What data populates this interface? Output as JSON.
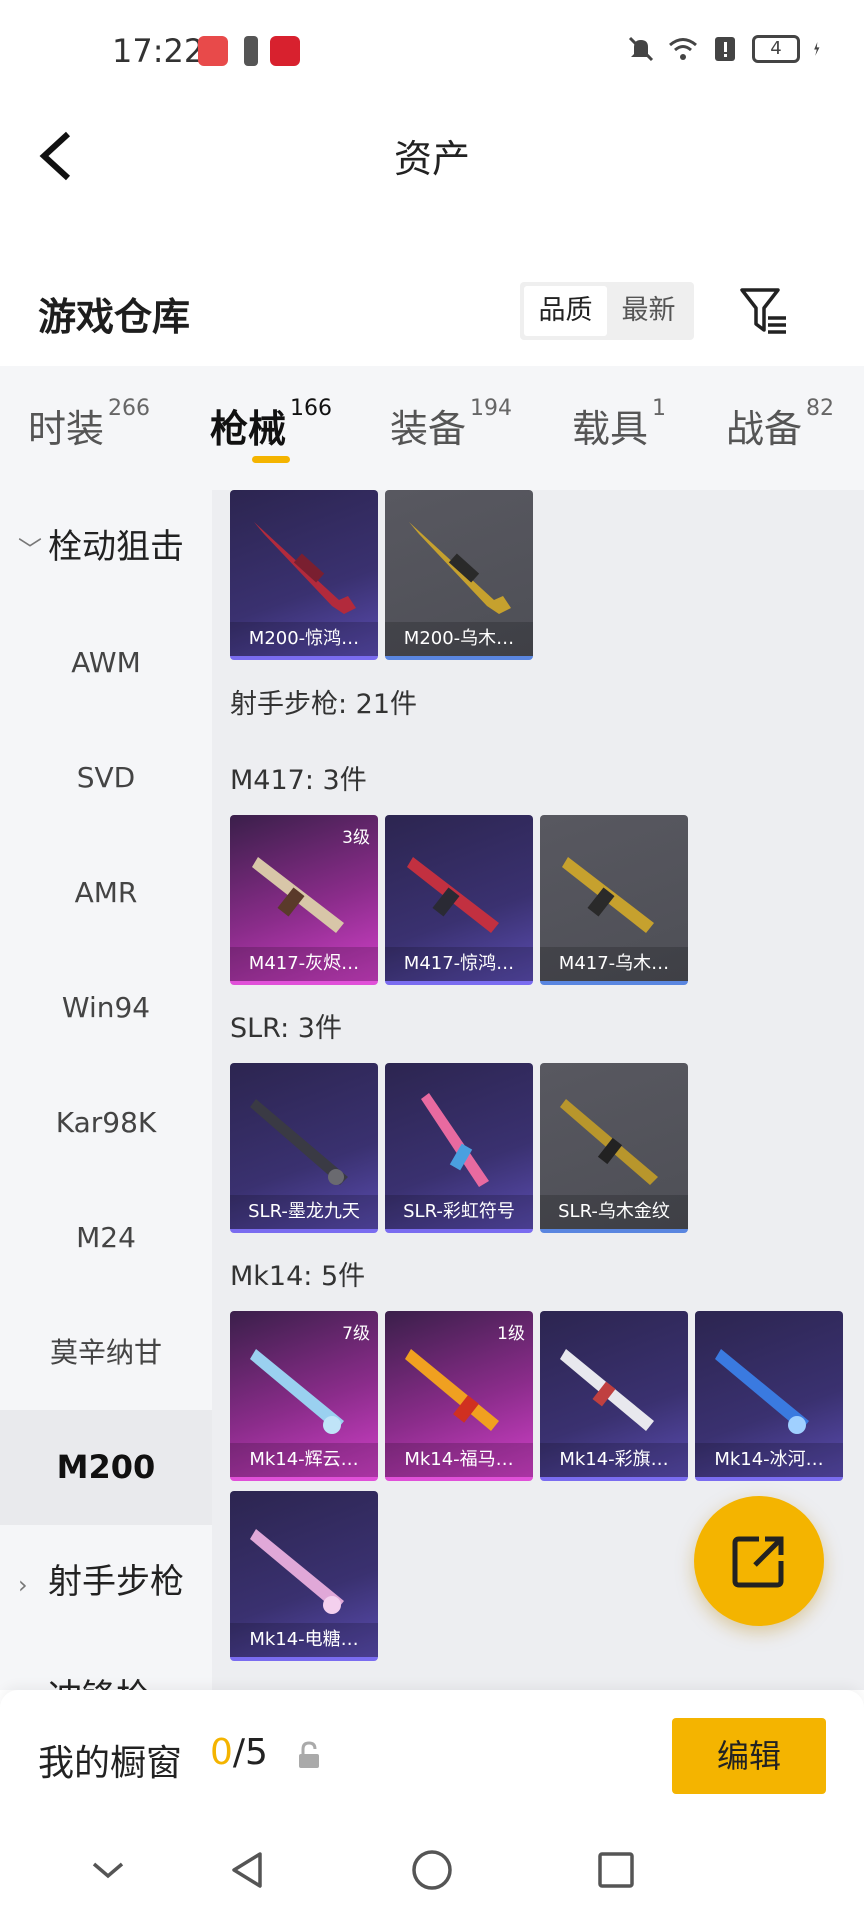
{
  "status_bar": {
    "time": "17:22",
    "battery": "4"
  },
  "header": {
    "title": "资产"
  },
  "warehouse": {
    "title": "游戏仓库",
    "sort_options": [
      "品质",
      "最新"
    ],
    "active_sort": "品质"
  },
  "category_tabs": [
    {
      "label": "时装",
      "count": "266",
      "active": false
    },
    {
      "label": "枪械",
      "count": "166",
      "active": true
    },
    {
      "label": "装备",
      "count": "194",
      "active": false
    },
    {
      "label": "载具",
      "count": "1",
      "active": false
    },
    {
      "label": "战备",
      "count": "82",
      "active": false
    }
  ],
  "sidebar": [
    {
      "label": "栓动狙击",
      "type": "group",
      "expanded": true
    },
    {
      "label": "AWM",
      "type": "item"
    },
    {
      "label": "SVD",
      "type": "item"
    },
    {
      "label": "AMR",
      "type": "item"
    },
    {
      "label": "Win94",
      "type": "item"
    },
    {
      "label": "Kar98K",
      "type": "item"
    },
    {
      "label": "M24",
      "type": "item"
    },
    {
      "label": "莫辛纳甘",
      "type": "item"
    },
    {
      "label": "M200",
      "type": "item",
      "active": true
    },
    {
      "label": "射手步枪",
      "type": "group",
      "expanded": false
    },
    {
      "label": "冲锋枪",
      "type": "group",
      "expanded": false
    }
  ],
  "content": {
    "top_cards": [
      {
        "name": "M200-惊鸿…",
        "style": "purple",
        "level": ""
      },
      {
        "name": "M200-乌木…",
        "style": "gray",
        "level": ""
      }
    ],
    "section_title": "射手步枪: 21件",
    "groups": [
      {
        "title": "M417: 3件",
        "cards": [
          {
            "name": "M417-灰烬…",
            "style": "pink",
            "level": "3级"
          },
          {
            "name": "M417-惊鸿…",
            "style": "purple",
            "level": ""
          },
          {
            "name": "M417-乌木…",
            "style": "gray",
            "level": ""
          }
        ]
      },
      {
        "title": "SLR: 3件",
        "cards": [
          {
            "name": "SLR-墨龙九天",
            "style": "purple",
            "level": ""
          },
          {
            "name": "SLR-彩虹符号",
            "style": "purple",
            "level": ""
          },
          {
            "name": "SLR-乌木金纹",
            "style": "gray",
            "level": ""
          }
        ]
      },
      {
        "title": "Mk14: 5件",
        "cards": [
          {
            "name": "Mk14-辉云…",
            "style": "pink",
            "level": "7级"
          },
          {
            "name": "Mk14-福马…",
            "style": "pink",
            "level": "1级"
          },
          {
            "name": "Mk14-彩旗…",
            "style": "purple",
            "level": ""
          },
          {
            "name": "Mk14-冰河…",
            "style": "purple",
            "level": ""
          },
          {
            "name": "Mk14-电糖…",
            "style": "purple",
            "level": ""
          }
        ]
      }
    ]
  },
  "showcase": {
    "label": "我的橱窗",
    "current": "0",
    "total": "/5",
    "edit_label": "编辑"
  },
  "colors": {
    "accent": "#f4b400",
    "purple_card": "#3a3170",
    "pink_card": "#b03cb0",
    "gray_card": "#55565c"
  },
  "icons": {
    "back": "chevron-left-icon",
    "filter": "filter-icon",
    "share": "share-icon",
    "lock": "lock-icon"
  }
}
